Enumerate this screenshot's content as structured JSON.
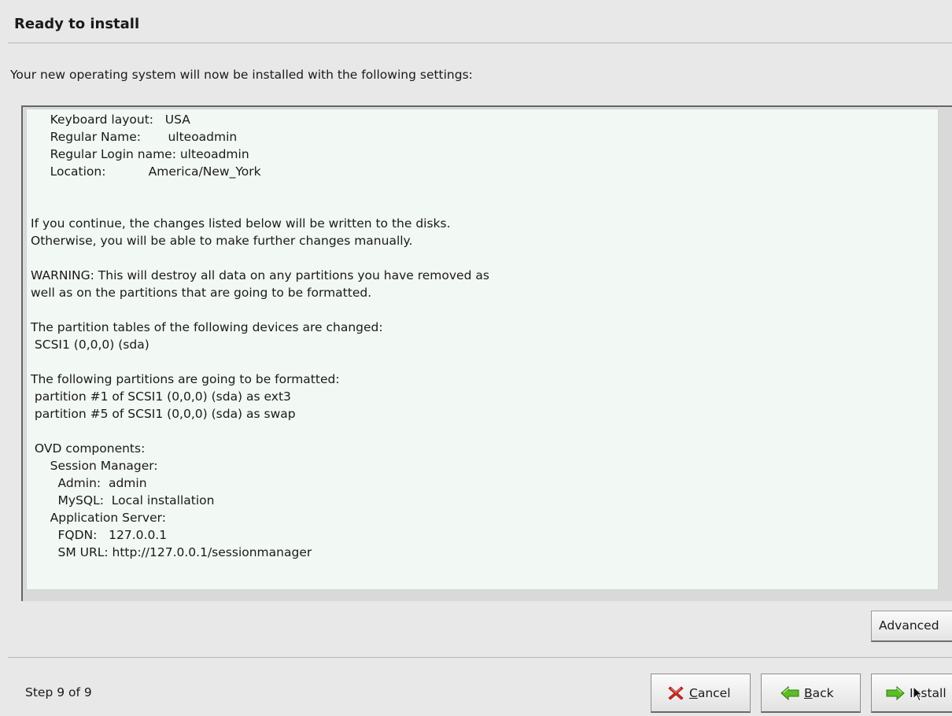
{
  "header": {
    "title": "Ready to install"
  },
  "intro": "Your new operating system will now be installed with the following settings:",
  "summary": {
    "lines": [
      "     Keyboard layout:   USA",
      "     Regular Name:       ulteoadmin",
      "     Regular Login name: ulteoadmin",
      "     Location:           America/New_York",
      "",
      "",
      "If you continue, the changes listed below will be written to the disks.",
      "Otherwise, you will be able to make further changes manually.",
      "",
      "WARNING: This will destroy all data on any partitions you have removed as",
      "well as on the partitions that are going to be formatted.",
      "",
      "The partition tables of the following devices are changed:",
      " SCSI1 (0,0,0) (sda)",
      "",
      "The following partitions are going to be formatted:",
      " partition #1 of SCSI1 (0,0,0) (sda) as ext3",
      " partition #5 of SCSI1 (0,0,0) (sda) as swap",
      "",
      " OVD components:",
      "     Session Manager:",
      "       Admin:  admin",
      "       MySQL:  Local installation",
      "     Application Server:",
      "       FQDN:   127.0.0.1",
      "       SM URL: http://127.0.0.1/sessionmanager"
    ]
  },
  "advanced_label": "Advanced",
  "footer": {
    "step": "Step 9 of 9",
    "cancel_mnemonic": "C",
    "cancel_rest": "ancel",
    "back_mnemonic": "B",
    "back_rest": "ack",
    "install_label": "Install"
  },
  "icons": {
    "cancel": "cancel-icon",
    "back": "arrow-left-icon",
    "install": "arrow-right-icon",
    "cursor": "mouse-pointer-icon"
  },
  "colors": {
    "cancel_icon": "#d9261c",
    "arrow_icon": "#4caf1e",
    "panel_bg": "#f2f8f4"
  }
}
